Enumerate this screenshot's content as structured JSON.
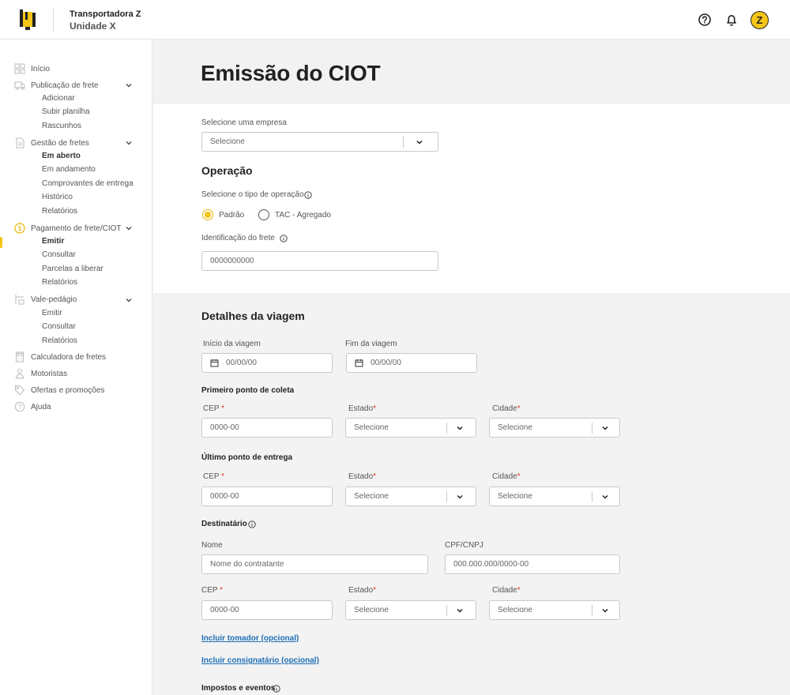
{
  "header": {
    "company": "Transportadora Z",
    "unit": "Unidade X",
    "avatar_letter": "Z",
    "icons": [
      "help-icon",
      "bell-icon"
    ],
    "brand_color": "#f5c518"
  },
  "sidebar": {
    "inicio": "Início",
    "publicacao": {
      "label": "Publicação de frete",
      "items": [
        "Adicionar",
        "Subir planilha",
        "Rascunhos"
      ]
    },
    "gestao": {
      "label": "Gestão de fretes",
      "items": [
        "Em aberto",
        "Em andamento",
        "Comprovantes de entrega",
        "Histórico",
        "Relatórios"
      ]
    },
    "pagamento": {
      "label": "Pagamento de frete/CIOT",
      "items": [
        "Emitir",
        "Consultar",
        "Parcelas a liberar",
        "Relatórios"
      ]
    },
    "vale": {
      "label": "Vale-pedágio",
      "items": [
        "Emitir",
        "Consultar",
        "Relatórios"
      ]
    },
    "calculadora": "Calculadora de fretes",
    "motoristas": "Motoristas",
    "ofertas": "Ofertas e promoções",
    "ajuda": "Ajuda"
  },
  "main": {
    "title": "Emissão do CIOT",
    "empresa": {
      "label": "Selecione uma empresa",
      "value": "Selecione"
    },
    "operacao": {
      "title": "Operação",
      "tipo_label": "Selecione o tipo de operação",
      "options": [
        "Padrão",
        "TAC - Agregado"
      ],
      "selected": "Padrão",
      "identificacao_label": "Identificação do frete",
      "identificacao_placeholder": "0000000000"
    },
    "viagem": {
      "title": "Detalhes da viagem",
      "inicio_label": "Início da viagem",
      "fim_label": "Fim da viagem",
      "date_placeholder": "00/00/00",
      "coleta_title": "Primeiro ponto de coleta",
      "entrega_title": "Último ponto de entrega",
      "cep_label": "CEP",
      "estado_label": "Estado",
      "cidade_label": "Cidade",
      "required_mark": "*",
      "cep_placeholder": "0000-00",
      "select_placeholder": "Selecione"
    },
    "destinatario": {
      "title": "Destinatário",
      "nome_label": "Nome",
      "nome_placeholder": "Nome do contratante",
      "doc_label": "CPF/CNPJ",
      "doc_placeholder": "000.000.000/0000-00"
    },
    "links": {
      "tomador": "Incluir tomador (opcional)",
      "consignatario": "Incluir consignatário (opcional)"
    },
    "impostos_title": "Impostos e eventos"
  }
}
